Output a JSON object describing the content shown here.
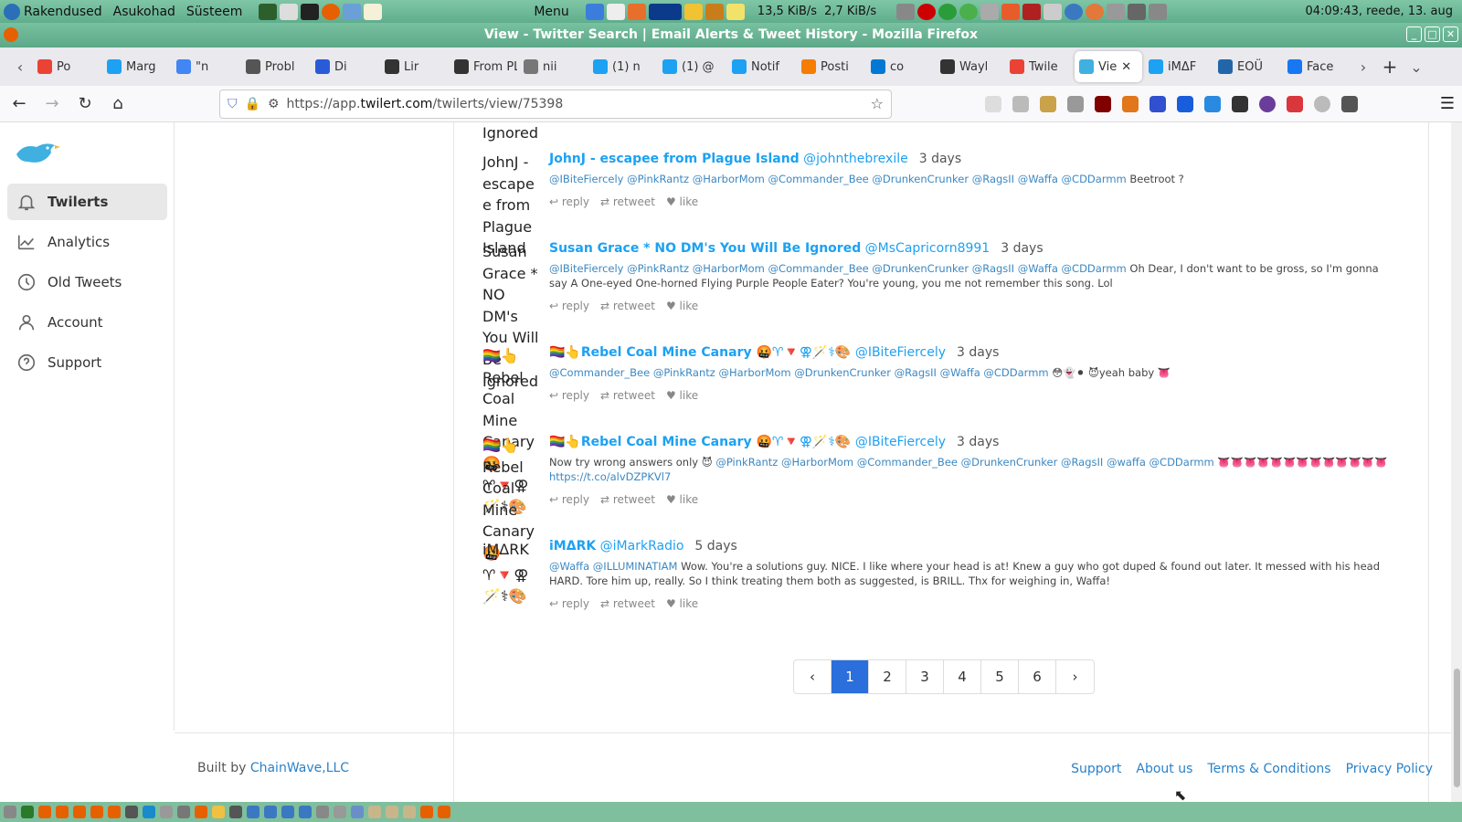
{
  "system_panel": {
    "menus": [
      "Rakendused",
      "Asukohad",
      "Süsteem"
    ],
    "menu_label": "Menu",
    "net_down": "13,5 KiB/s",
    "net_up": "2,7 KiB/s",
    "clock": "04:09:43, reede, 13. aug"
  },
  "window": {
    "title": "View - Twitter Search | Email Alerts & Tweet History - Mozilla Firefox"
  },
  "tabs": [
    {
      "label": "Po",
      "icon": "gmail-icon",
      "color": "#ea4335"
    },
    {
      "label": "Marg",
      "icon": "twitter-icon",
      "color": "#1da1f2"
    },
    {
      "label": "\"n",
      "icon": "google-icon",
      "color": "#4285f4"
    },
    {
      "label": "Probl",
      "icon": "info-icon",
      "color": "#555555"
    },
    {
      "label": "Di",
      "icon": "a-icon",
      "color": "#2a5bd7"
    },
    {
      "label": "Lir",
      "icon": "a-icon",
      "color": "#333333"
    },
    {
      "label": "From PLAYIN",
      "icon": "media-icon",
      "color": "#333333"
    },
    {
      "label": "nii",
      "icon": "image-icon",
      "color": "#777777"
    },
    {
      "label": "(1) n",
      "icon": "twitter-icon",
      "color": "#1da1f2"
    },
    {
      "label": "(1) @",
      "icon": "twitter-icon",
      "color": "#1da1f2"
    },
    {
      "label": "Notif",
      "icon": "twitter-icon",
      "color": "#1da1f2"
    },
    {
      "label": "Posti",
      "icon": "blogger-icon",
      "color": "#f57d00"
    },
    {
      "label": "co",
      "icon": "bing-icon",
      "color": "#0078d4"
    },
    {
      "label": "Wayl",
      "icon": "archive-icon",
      "color": "#333333"
    },
    {
      "label": "Twile",
      "icon": "gmail-icon",
      "color": "#ea4335"
    },
    {
      "label": "Vie",
      "icon": "twilert-icon",
      "color": "#3fb0e0",
      "active": true
    },
    {
      "label": "iMΔF",
      "icon": "twitter-icon",
      "color": "#1da1f2"
    },
    {
      "label": "EOÜ",
      "icon": "terminal-icon",
      "color": "#2266aa"
    },
    {
      "label": "Face",
      "icon": "facebook-icon",
      "color": "#1877f2"
    }
  ],
  "nav": {
    "url_prefix": "https://app.",
    "url_domain": "twilert.com",
    "url_path": "/twilerts/view/75398"
  },
  "sidebar": {
    "brand": "twilert",
    "items": [
      {
        "label": "Twilerts",
        "icon": "bell-icon",
        "active": true
      },
      {
        "label": "Analytics",
        "icon": "chart-icon"
      },
      {
        "label": "Old Tweets",
        "icon": "clock-icon"
      },
      {
        "label": "Account",
        "icon": "user-icon"
      },
      {
        "label": "Support",
        "icon": "help-icon"
      }
    ]
  },
  "namecol": {
    "ignored_top": "Ignored",
    "johnj": "JohnJ - escapee from Plague Island",
    "susan": "Susan Grace * NO DM's You Will Be Ignored",
    "rebel1": "🏳️‍🌈👆 Rebel Coal Mine Canary 🤬♈🔻⚢🪄⚕🎨",
    "rebel2": "🏳️‍🌈👆 Rebel Coal Mine Canary 🤬♈🔻⚢🪄⚕🎨",
    "imark": "iMΔRK"
  },
  "tweets": [
    {
      "name": "JohnJ - escapee from Plague Island",
      "handle": "@johnthebrexile",
      "age": "3 days",
      "mentions": "@IBiteFiercely @PinkRantz @HarborMom @Commander_Bee @DrunkenCrunker @RagsII @Waffa @CDDarmm",
      "text": "Beetroot ?"
    },
    {
      "name": "Susan Grace * NO DM's You Will Be Ignored",
      "handle": "@MsCapricorn8991",
      "age": "3 days",
      "mentions": "@IBiteFiercely @PinkRantz @HarborMom @Commander_Bee @DrunkenCrunker @RagsII @Waffa @CDDarmm",
      "text": "Oh Dear, I don't want to be gross, so I'm gonna say A One-eyed One-horned Flying Purple People Eater? You're young, you me not remember this song. Lol"
    },
    {
      "name": "🏳️‍🌈👆Rebel Coal Mine Canary 🤬♈🔻⚢🪄⚕🎨",
      "handle": "@IBiteFiercely",
      "age": "3 days",
      "mentions": "@Commander_Bee @PinkRantz @HarborMom @DrunkenCrunker @RagsII @Waffa @CDDarmm",
      "text": "😳👻⚫ 😈yeah baby 👅"
    },
    {
      "name": "🏳️‍🌈👆Rebel Coal Mine Canary 🤬♈🔻⚢🪄⚕🎨",
      "handle": "@IBiteFiercely",
      "age": "3 days",
      "pre": "Now try wrong answers only 😈",
      "mentions": "@PinkRantz @HarborMom @Commander_Bee @DrunkenCrunker @RagsII @waffa @CDDarmm",
      "text": "👅👅👅👅👅👅👅👅👅👅👅👅👅",
      "link": "https://t.co/alvDZPKVl7"
    },
    {
      "name": "iMΔRK",
      "handle": "@iMarkRadio",
      "age": "5 days",
      "mentions": "@Waffa @ILLUMINATIAM",
      "text": "Wow. You're a solutions guy. NICE. I like where your head is at! Knew a guy who got duped & found out later. It messed with his head HARD. Tore him up, really. So I think treating them both as suggested, is BRILL. Thx for weighing in, Waffa!"
    }
  ],
  "actions": {
    "reply": "reply",
    "retweet": "retweet",
    "like": "like"
  },
  "pagination": {
    "prev": "‹",
    "next": "›",
    "pages": [
      "1",
      "2",
      "3",
      "4",
      "5",
      "6"
    ],
    "current": "1"
  },
  "footer": {
    "built_by": "Built by",
    "company": "ChainWave,LLC",
    "links": [
      "Support",
      "About us",
      "Terms & Conditions",
      "Privacy Policy"
    ]
  }
}
